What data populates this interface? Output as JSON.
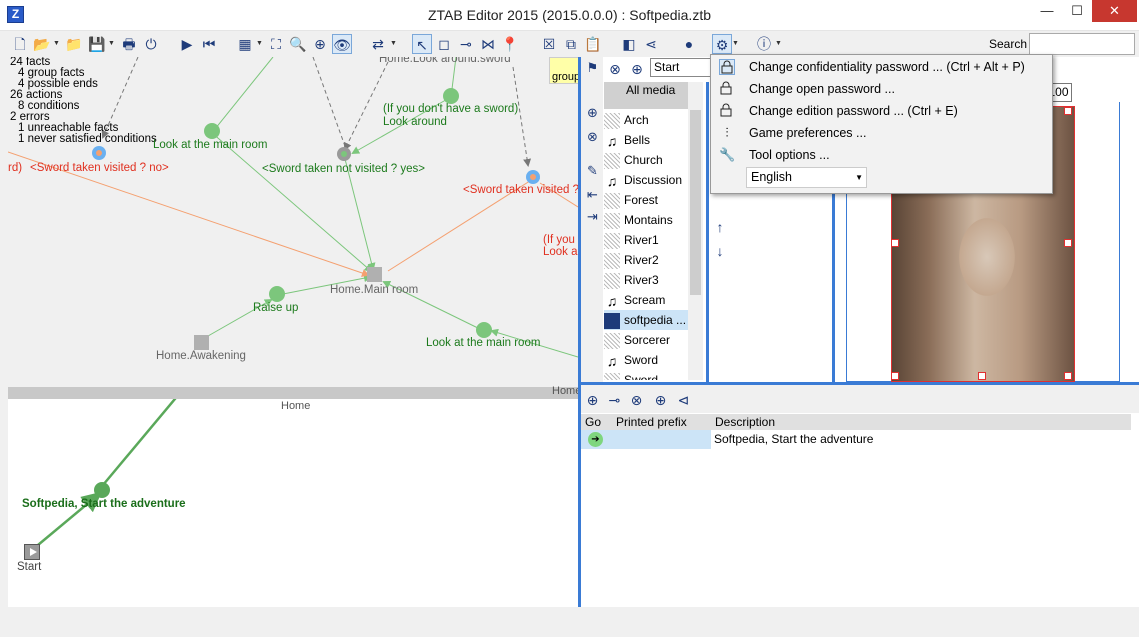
{
  "window": {
    "title": "ZTAB Editor 2015 (2015.0.0.0) : Softpedia.ztb",
    "app_icon_letter": "Z",
    "minimize": "—",
    "maximize": "☐",
    "close": "✕"
  },
  "toolbar": {
    "search_label": "Search",
    "search_value": ""
  },
  "stats": [
    "24 facts",
    "4 group facts",
    "4 possible ends",
    "26 actions",
    "8 conditions",
    "2 errors",
    "1 unreachable facts",
    "1 never satisfied conditions"
  ],
  "graph": {
    "labels": {
      "look_around_sword": "Home.Look around.sword",
      "if_no_sword": "(If you don't have a sword)",
      "look_around": "Look around",
      "look_main_room_1": "Look at the main room",
      "sword_not_visited_yes": "<Sword taken not visited ? yes>",
      "sword_visited_no": "<Sword taken visited ? no>",
      "cut_rd": "rd)",
      "sword_taken_visited_cut": "<Sword taken visited ?",
      "if_you_cut": "(If you",
      "look_ar_cut": "Look ar",
      "home_main_room": "Home.Main room",
      "raise_up": "Raise up",
      "home_awakening": "Home.Awakening",
      "look_main_room_2": "Look at the main room",
      "group_tag": "group"
    },
    "split_label": "Home",
    "lower_home": "Home",
    "softpedia_start": "Softpedia, Start the adventure",
    "start": "Start"
  },
  "right_panel": {
    "start_input": "Start",
    "number_box": "100",
    "media": [
      {
        "label": "All media",
        "icon": "",
        "all": true
      },
      {
        "label": "Arch",
        "icon": "noise"
      },
      {
        "label": "Bells",
        "icon": "music"
      },
      {
        "label": "Church",
        "icon": "noise"
      },
      {
        "label": "Discussion",
        "icon": "music"
      },
      {
        "label": "Forest",
        "icon": "noise"
      },
      {
        "label": "Montains",
        "icon": "noise"
      },
      {
        "label": "River1",
        "icon": "noise"
      },
      {
        "label": "River2",
        "icon": "noise"
      },
      {
        "label": "River3",
        "icon": "noise"
      },
      {
        "label": "Scream",
        "icon": "music"
      },
      {
        "label": "softpedia ...",
        "icon": "thumb",
        "selected": true
      },
      {
        "label": "Sorcerer",
        "icon": "noise"
      },
      {
        "label": "Sword",
        "icon": "music"
      },
      {
        "label": "Sword",
        "icon": "noise"
      }
    ]
  },
  "lower_table": {
    "headers": {
      "go": "Go",
      "prefix": "Printed prefix",
      "description": "Description"
    },
    "rows": [
      {
        "prefix": "",
        "description": "Softpedia, Start the adventure"
      }
    ]
  },
  "menu": {
    "items": [
      {
        "label": "Change confidentiality password ... (Ctrl + Alt + P)",
        "icon": "lock-icon",
        "hover": true
      },
      {
        "label": "Change open password ...",
        "icon": "lock-icon"
      },
      {
        "label": "Change edition password ... (Ctrl + E)",
        "icon": "lock-icon"
      },
      {
        "label": "Game preferences ...",
        "icon": "sliders-icon"
      },
      {
        "label": "Tool options ...",
        "icon": "wrench-icon"
      }
    ],
    "language": "English"
  }
}
